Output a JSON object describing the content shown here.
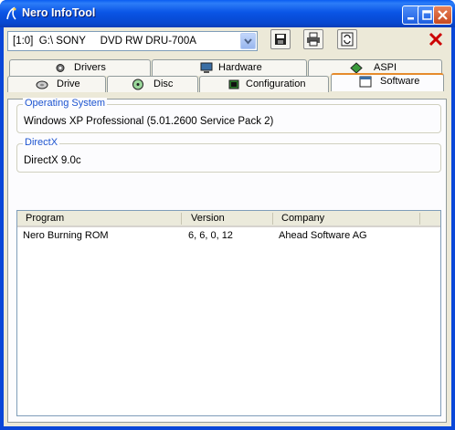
{
  "window": {
    "title": "Nero InfoTool"
  },
  "toolbar": {
    "drive_selected": "[1:0]  G:\\ SONY     DVD RW DRU-700A",
    "buttons": [
      "floppy-save-icon",
      "printer-icon",
      "refresh-icon",
      "exit-icon"
    ]
  },
  "tabs": {
    "row_back": [
      {
        "label": "Drivers",
        "icon": "gear-icon"
      },
      {
        "label": "Hardware",
        "icon": "computer-icon"
      },
      {
        "label": "ASPI",
        "icon": "diamond-arrows-icon"
      }
    ],
    "row_front": [
      {
        "label": "Drive",
        "icon": "drive-icon"
      },
      {
        "label": "Disc",
        "icon": "disc-icon"
      },
      {
        "label": "Configuration",
        "icon": "chip-icon"
      },
      {
        "label": "Software",
        "icon": "window-icon",
        "active": true
      }
    ]
  },
  "os_group": {
    "label": "Operating System",
    "value": "Windows XP Professional (5.01.2600 Service Pack 2)"
  },
  "directx_group": {
    "label": "DirectX",
    "value": "DirectX 9.0c"
  },
  "program_list": {
    "columns": [
      "Program",
      "Version",
      "Company"
    ],
    "rows": [
      {
        "program": "Nero Burning ROM",
        "version": "6, 6, 0, 12",
        "company": "Ahead Software AG"
      }
    ]
  },
  "colors": {
    "accent_tab": "#e68b2c",
    "group_label": "#1d54d0",
    "exit_red": "#cc0000"
  }
}
